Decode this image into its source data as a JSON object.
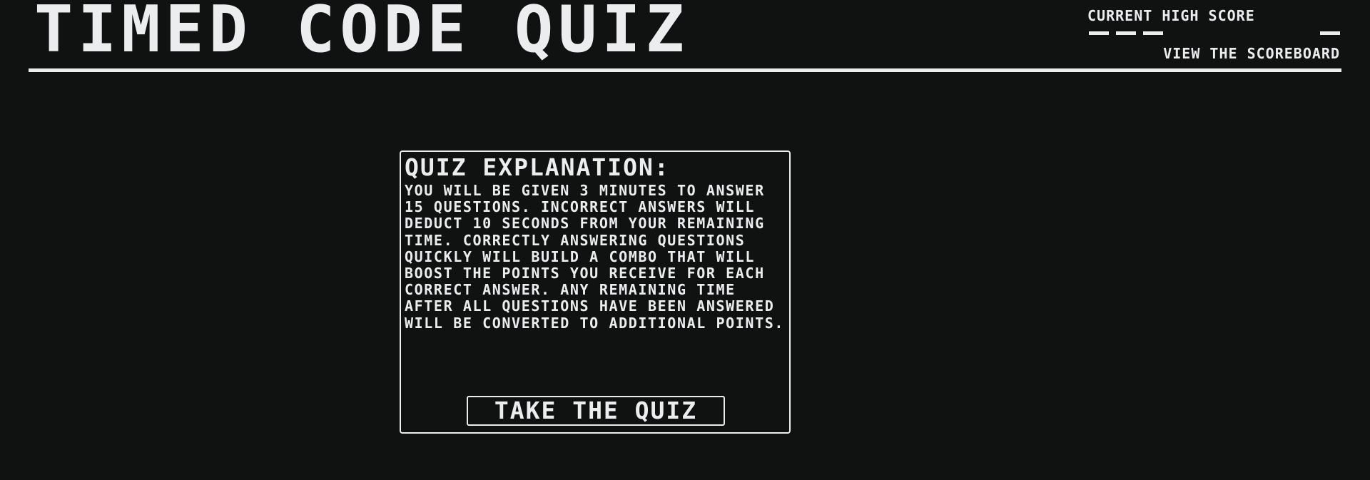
{
  "header": {
    "title": "TIMED CODE QUIZ",
    "high_score_label": "CURRENT HIGH SCORE",
    "high_score_value": "___ _",
    "scoreboard_link": "VIEW THE SCOREBOARD"
  },
  "explanation": {
    "heading": "QUIZ EXPLANATION:",
    "body": "YOU WILL BE GIVEN 3 MINUTES TO ANSWER 15 QUESTIONS. INCORRECT ANSWERS WILL DEDUCT 10 SECONDS FROM YOUR REMAINING TIME. CORRECTLY ANSWERING QUESTIONS QUICKLY WILL BUILD A COMBO THAT WILL BOOST THE POINTS YOU RECEIVE FOR EACH CORRECT ANSWER. ANY REMAINING TIME AFTER ALL QUESTIONS HAVE BEEN ANSWERED WILL BE CONVERTED TO ADDITIONAL POINTS.",
    "start_button": "TAKE THE QUIZ"
  },
  "colors": {
    "background": "#101212",
    "foreground": "#ecedef"
  }
}
